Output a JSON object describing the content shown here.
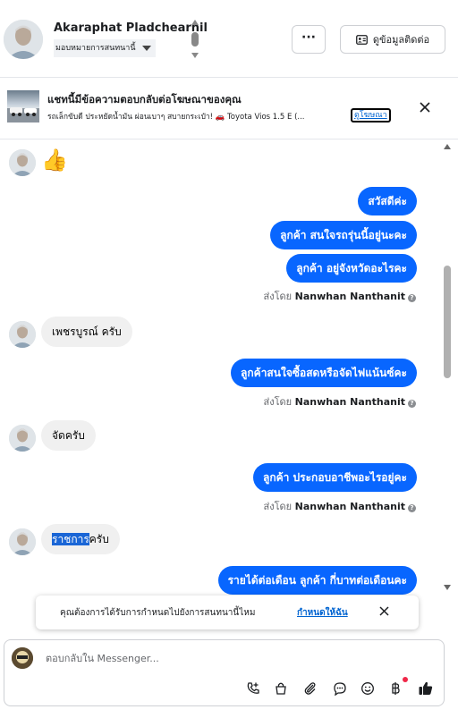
{
  "header": {
    "contact_name": "Akaraphat Pladchearnil",
    "assign_label": "มอบหมายการสนทนานี้",
    "more_label": "···",
    "contact_info_label": "ดูข้อมูลติดต่อ"
  },
  "ad_banner": {
    "title": "แชทนี้มีข้อความตอบกลับต่อโฆษณาของคุณ",
    "subtitle": "รถเล็กขับดี ประหยัดน้ำมัน ผ่อนเบาๆ สบายกระเป๋า! 🚗 Toyota Vios 1.5 E (...",
    "view_ad_label": "ดูโฆษณา"
  },
  "messages": [
    {
      "id": "m1",
      "from": "customer",
      "emoji": "👍"
    },
    {
      "id": "m2",
      "from": "page",
      "text": "สวัสดีค่ะ"
    },
    {
      "id": "m3",
      "from": "page",
      "text": "ลูกค้า สนใจรถรุ่นนี้อยู่นะคะ"
    },
    {
      "id": "m4",
      "from": "page",
      "text": "ลูกค้า อยู่จังหวัดอะไรคะ"
    },
    {
      "id": "s1",
      "sent_by_prefix": "ส่งโดย",
      "sent_by_name": "Nanwhan Nanthanit"
    },
    {
      "id": "m5",
      "from": "customer",
      "text": "เพชรบูรณ์ ครับ"
    },
    {
      "id": "m6",
      "from": "page",
      "text": "ลูกค้าสนใจซื้อสดหรือจัดไฟแน้นซ์คะ"
    },
    {
      "id": "s2",
      "sent_by_prefix": "ส่งโดย",
      "sent_by_name": "Nanwhan Nanthanit"
    },
    {
      "id": "m7",
      "from": "customer",
      "text": "จัดครับ"
    },
    {
      "id": "m8",
      "from": "page",
      "text": "ลูกค้า ประกอบอาชีพอะไรอยู่คะ"
    },
    {
      "id": "s3",
      "sent_by_prefix": "ส่งโดย",
      "sent_by_name": "Nanwhan Nanthanit"
    },
    {
      "id": "m9",
      "from": "customer",
      "text_highlight": "ราชการ",
      "text_rest": "ครับ"
    },
    {
      "id": "m10",
      "from": "page",
      "text": "รายได้ต่อเดือน  ลูกค้า  กี่บาทต่อเดือนคะ"
    }
  ],
  "toast": {
    "text": "คุณต้องการได้รับการกำหนดไปยังการสนทนานี้ไหม",
    "link": "กำหนดให้ฉัน"
  },
  "composer": {
    "placeholder": "ตอบกลับใน Messenger..."
  },
  "icons": {
    "accent": "#0866ff",
    "tools": [
      "call-add-icon",
      "bag-icon",
      "attach-icon",
      "saved-reply-icon",
      "emoji-icon",
      "baht-icon",
      "thumbs-up-icon"
    ]
  }
}
